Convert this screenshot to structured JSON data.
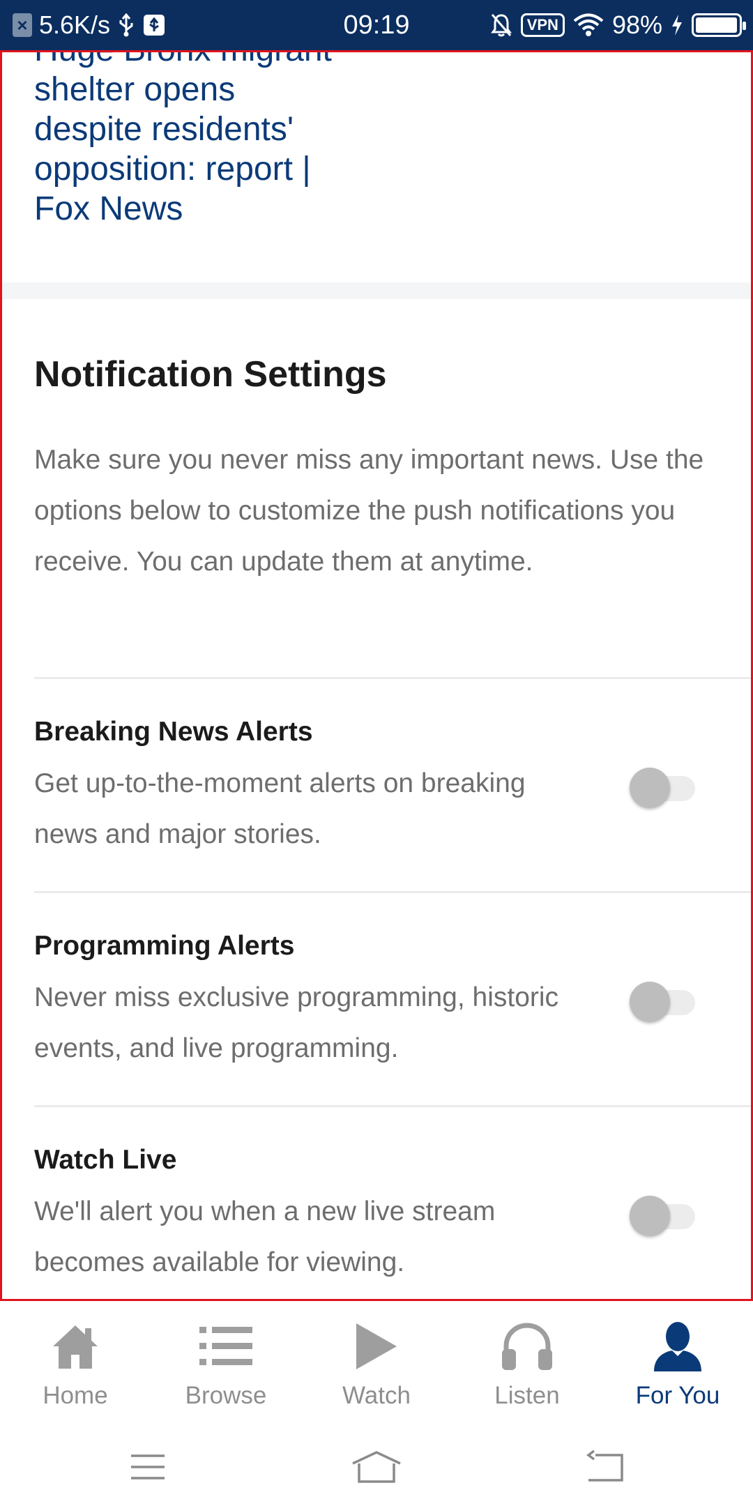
{
  "status_bar": {
    "network_speed": "5.6K/s",
    "time": "09:19",
    "vpn_label": "VPN",
    "battery_percent": "98%",
    "battery_level": 0.98,
    "icons": [
      "close-box-icon",
      "usb-icon",
      "usb-debug-icon",
      "mute-bell-icon",
      "vpn-icon",
      "wifi-icon",
      "charging-icon",
      "battery-icon"
    ]
  },
  "article": {
    "title_lines": [
      "Huge Bronx migrant",
      "shelter opens",
      "despite residents'",
      "opposition: report |",
      "Fox News"
    ]
  },
  "notifications": {
    "heading": "Notification Settings",
    "intro": "Make sure you never miss any important news. Use the options below to customize the push notifications you receive. You can update them at anytime.",
    "settings": [
      {
        "title": "Breaking News Alerts",
        "description": "Get up-to-the-moment alerts on breaking news and major stories.",
        "enabled": false
      },
      {
        "title": "Programming Alerts",
        "description": "Never miss exclusive programming, historic events, and live programming.",
        "enabled": false
      },
      {
        "title": "Watch Live",
        "description": "We'll alert you when a new live stream becomes available for viewing.",
        "enabled": false
      }
    ]
  },
  "tab_bar": {
    "tabs": [
      {
        "label": "Home",
        "icon": "home-icon",
        "active": false
      },
      {
        "label": "Browse",
        "icon": "list-icon",
        "active": false
      },
      {
        "label": "Watch",
        "icon": "play-icon",
        "active": false
      },
      {
        "label": "Listen",
        "icon": "headphones-icon",
        "active": false
      },
      {
        "label": "For You",
        "icon": "person-icon",
        "active": true
      }
    ],
    "active_color": "#0b3a78",
    "inactive_color": "#8e8e8e"
  },
  "system_nav": {
    "buttons": [
      "menu-icon",
      "home-outline-icon",
      "back-icon"
    ]
  },
  "colors": {
    "status_bar_bg": "#0b2e5f",
    "headline_blue": "#0b3a78",
    "highlight_border": "#e0141e"
  }
}
